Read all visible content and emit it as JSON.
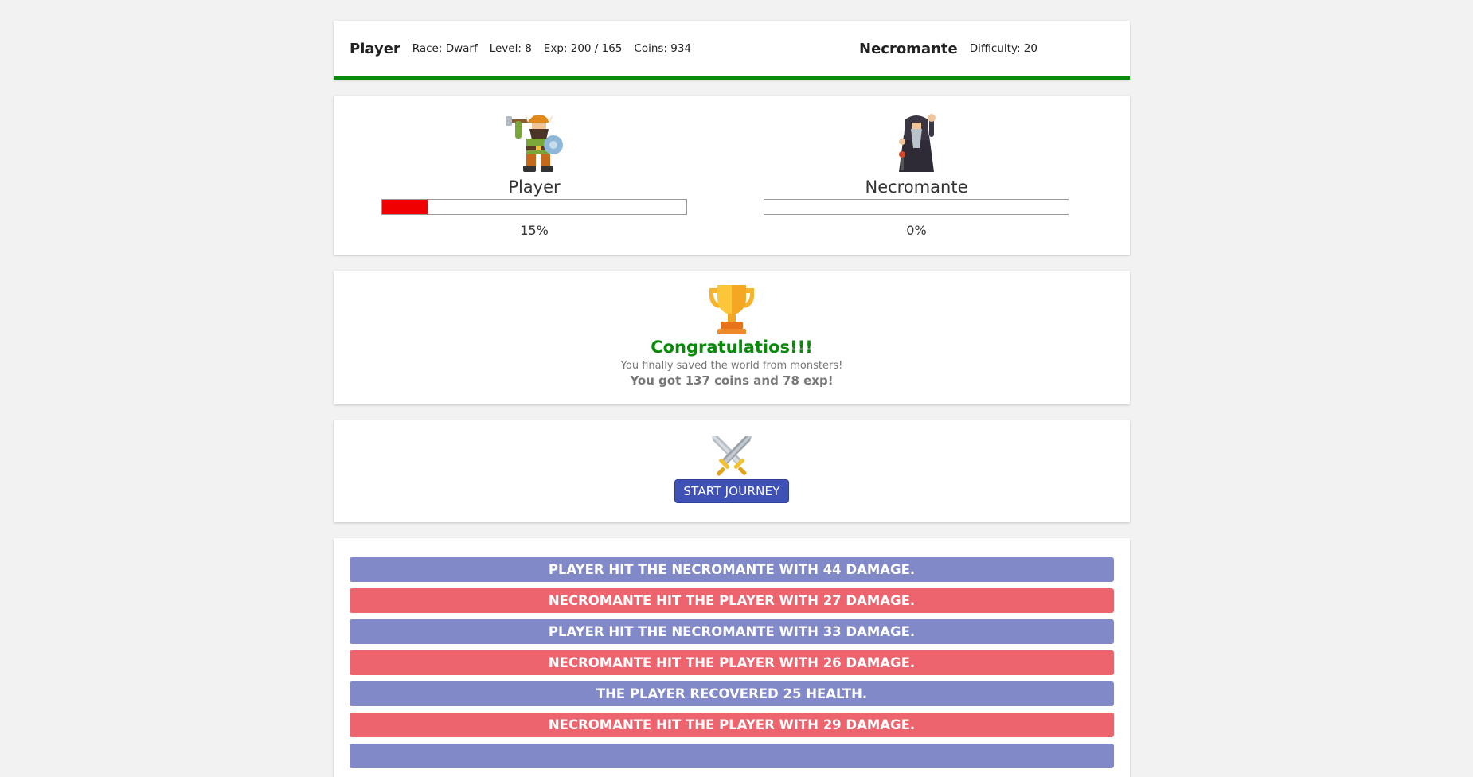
{
  "header": {
    "player_name": "Player",
    "race": "Race: Dwarf",
    "level": "Level: 8",
    "exp": "Exp: 200 / 165",
    "coins": "Coins: 934",
    "enemy_name": "Necromante",
    "difficulty": "Difficulty: 20",
    "border_color": "#0a8a0a"
  },
  "battle": {
    "player": {
      "name": "Player",
      "health_percent": 15,
      "health_label": "15%",
      "bar_color": "#f00000"
    },
    "enemy": {
      "name": "Necromante",
      "health_percent": 0,
      "health_label": "0%",
      "bar_color": "#f00000"
    }
  },
  "victory": {
    "icon": "trophy-icon",
    "title": "Congratulatios!!!",
    "message": "You finally saved the world from monsters!",
    "reward": "You got 137 coins and 78 exp!",
    "title_color": "#0a8a0a"
  },
  "journey": {
    "icon": "crossed-swords-icon",
    "button_label": "START JOURNEY",
    "button_color": "#3f51b5"
  },
  "log": {
    "player_color": "#8189c8",
    "monster_color": "#ee646e",
    "entries": [
      {
        "text": "PLAYER HIT THE NECROMANTE WITH 44 DAMAGE.",
        "side": "player"
      },
      {
        "text": "NECROMANTE HIT THE PLAYER WITH 27 DAMAGE.",
        "side": "monster"
      },
      {
        "text": "PLAYER HIT THE NECROMANTE WITH 33 DAMAGE.",
        "side": "player"
      },
      {
        "text": "NECROMANTE HIT THE PLAYER WITH 26 DAMAGE.",
        "side": "monster"
      },
      {
        "text": "THE PLAYER RECOVERED 25 HEALTH.",
        "side": "player"
      },
      {
        "text": "NECROMANTE HIT THE PLAYER WITH 29 DAMAGE.",
        "side": "monster"
      },
      {
        "text": "",
        "side": "player"
      }
    ]
  }
}
